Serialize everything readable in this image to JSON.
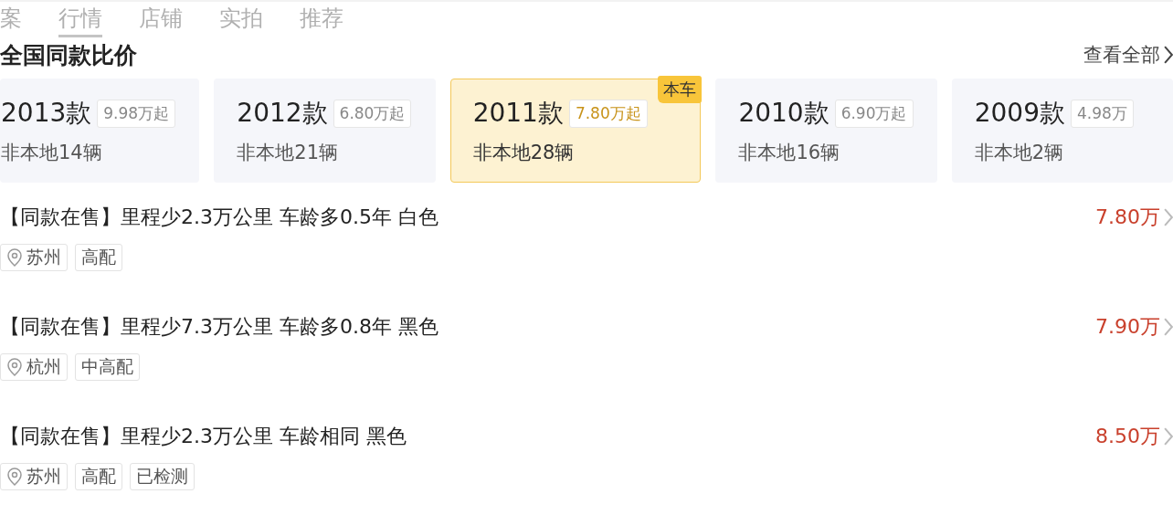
{
  "tabs": [
    {
      "label": "案",
      "selected": false
    },
    {
      "label": "行情",
      "selected": true
    },
    {
      "label": "店铺",
      "selected": false
    },
    {
      "label": "实拍",
      "selected": false
    },
    {
      "label": "推荐",
      "selected": false
    }
  ],
  "section": {
    "title": "全国同款比价",
    "link": "查看全部"
  },
  "years": [
    {
      "year": "2013款",
      "price": "9.98万起",
      "count": "非本地14辆",
      "selected": false
    },
    {
      "year": "2012款",
      "price": "6.80万起",
      "count": "非本地21辆",
      "selected": false
    },
    {
      "year": "2011款",
      "price": "7.80万起",
      "count": "非本地28辆",
      "selected": true,
      "badge": "本车"
    },
    {
      "year": "2010款",
      "price": "6.90万起",
      "count": "非本地16辆",
      "selected": false
    },
    {
      "year": "2009款",
      "price": "4.98万",
      "count": "非本地2辆",
      "selected": false
    }
  ],
  "listings": [
    {
      "title": "【同款在售】里程少2.3万公里 车龄多0.5年 白色",
      "price": "7.80万",
      "tags": [
        {
          "kind": "location",
          "label": "苏州"
        },
        {
          "kind": "plain",
          "label": "高配"
        }
      ]
    },
    {
      "title": "【同款在售】里程少7.3万公里 车龄多0.8年 黑色",
      "price": "7.90万",
      "tags": [
        {
          "kind": "location",
          "label": "杭州"
        },
        {
          "kind": "plain",
          "label": "中高配"
        }
      ]
    },
    {
      "title": "【同款在售】里程少2.3万公里 车龄相同 黑色",
      "price": "8.50万",
      "tags": [
        {
          "kind": "location",
          "label": "苏州"
        },
        {
          "kind": "plain",
          "label": "高配"
        },
        {
          "kind": "plain",
          "label": "已检测"
        }
      ]
    }
  ]
}
